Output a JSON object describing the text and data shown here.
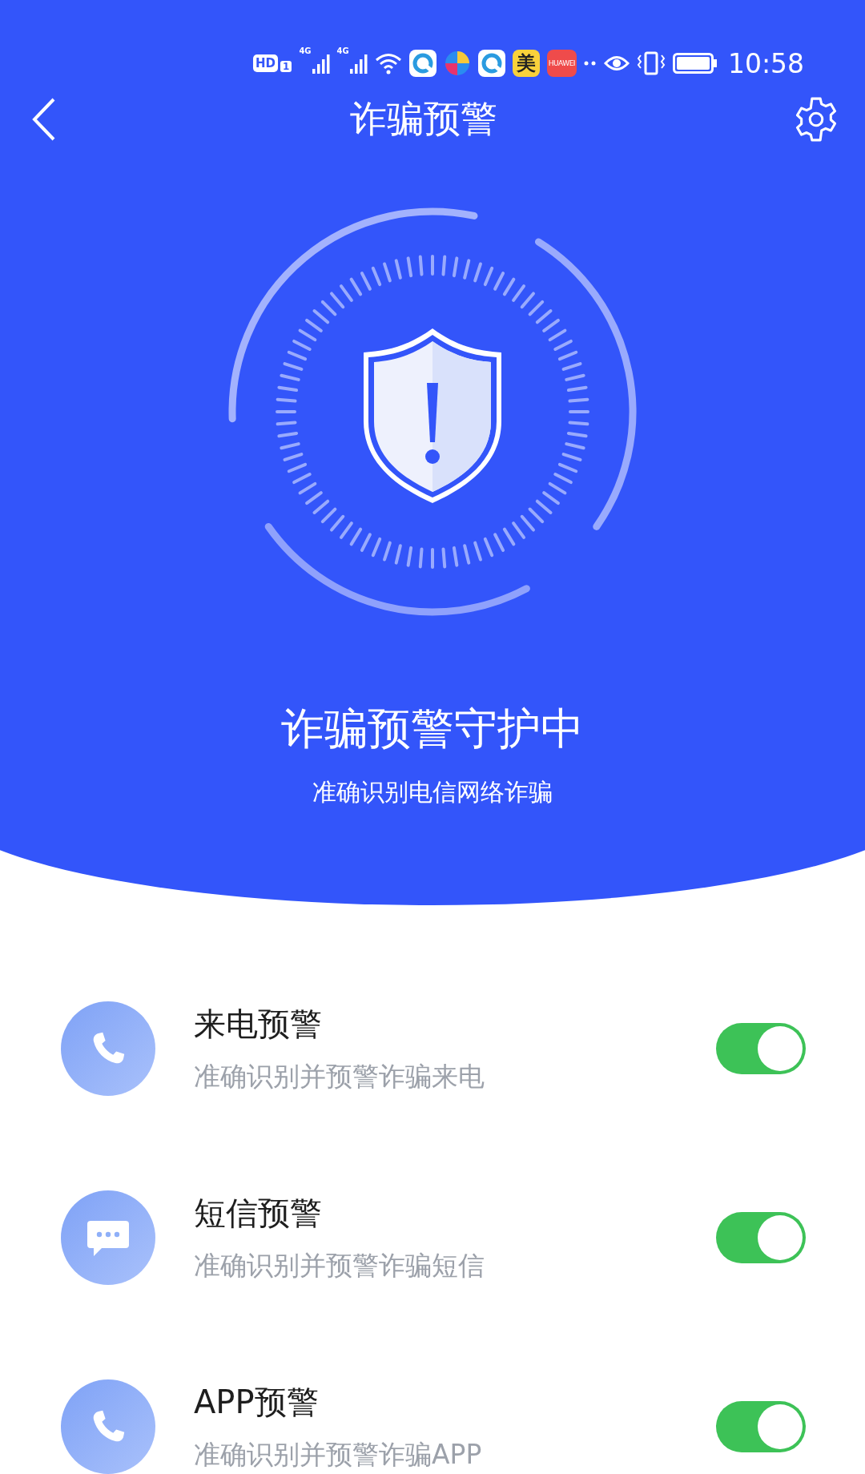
{
  "status_bar": {
    "hd_label": "HD",
    "sim_label": "1",
    "networks": [
      "4G",
      "4G"
    ],
    "apps": [
      {
        "kind": "browser"
      },
      {
        "kind": "pinwheel"
      },
      {
        "kind": "browser"
      },
      {
        "kind": "letter",
        "label": "美"
      },
      {
        "kind": "store",
        "label": "HUAWEI"
      }
    ],
    "time": "10:58"
  },
  "nav": {
    "title": "诈骗预警"
  },
  "hero": {
    "headline": "诈骗预警守护中",
    "subtitle": "准确识别电信网络诈骗"
  },
  "features": [
    {
      "kind": "phone",
      "title": "来电预警",
      "subtitle": "准确识别并预警诈骗来电",
      "on": true
    },
    {
      "kind": "message",
      "title": "短信预警",
      "subtitle": "准确识别并预警诈骗短信",
      "on": true
    },
    {
      "kind": "phone",
      "title": "APP预警",
      "subtitle": "准确识别并预警诈骗APP",
      "on": true
    }
  ]
}
